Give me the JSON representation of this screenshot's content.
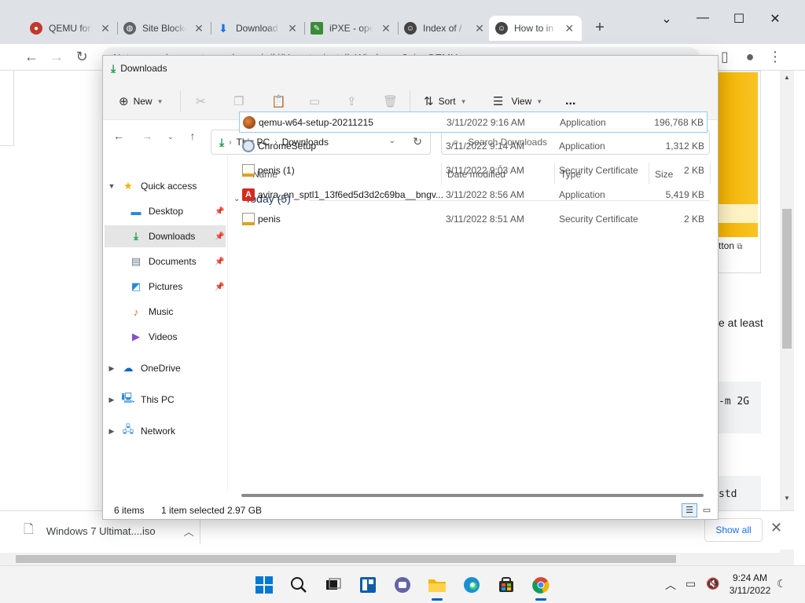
{
  "browser": {
    "tabs": [
      {
        "title": "QEMU for",
        "icon": "qemu-icon"
      },
      {
        "title": "Site Blocke",
        "icon": "globe-icon"
      },
      {
        "title": "Download",
        "icon": "download-icon"
      },
      {
        "title": "iPXE - ope",
        "icon": "ipxe-icon"
      },
      {
        "title": "Index of /",
        "icon": "web-icon"
      },
      {
        "title": "How to in",
        "icon": "web-icon"
      }
    ],
    "url": "Not secure | computernewb.com/wiki/How_to_install_Windows_8_in_QEMU",
    "page_text": {
      "button_fragment": "tton",
      "at_least": "e at least",
      "code1": "-m 2G",
      "code2": "std"
    },
    "download_bar": {
      "file": "Windows 7 Ultimat....iso",
      "show_all": "Show all"
    }
  },
  "explorer": {
    "title": "Downloads",
    "commands": {
      "new": "New",
      "sort": "Sort",
      "view": "View",
      "more": "..."
    },
    "address": {
      "segments": [
        "This PC",
        "Downloads"
      ]
    },
    "search_placeholder": "Search Downloads",
    "sidebar": [
      {
        "label": "Quick access",
        "icon": "star-icon",
        "pinned": false
      },
      {
        "label": "Desktop",
        "icon": "desktop-icon",
        "pinned": true
      },
      {
        "label": "Downloads",
        "icon": "download-icon",
        "pinned": true,
        "selected": true
      },
      {
        "label": "Documents",
        "icon": "documents-icon",
        "pinned": true
      },
      {
        "label": "Pictures",
        "icon": "pictures-icon",
        "pinned": true
      },
      {
        "label": "Music",
        "icon": "music-icon",
        "pinned": false
      },
      {
        "label": "Videos",
        "icon": "videos-icon",
        "pinned": false
      },
      {
        "label": "OneDrive",
        "icon": "cloud-icon",
        "pinned": false
      },
      {
        "label": "This PC",
        "icon": "pc-icon",
        "pinned": false
      },
      {
        "label": "Network",
        "icon": "network-icon",
        "pinned": false
      }
    ],
    "columns": [
      "Name",
      "Date modified",
      "Type",
      "Size"
    ],
    "group": "Today (5)",
    "files": [
      {
        "name": "qemu-w64-setup-20211215",
        "date": "3/11/2022 9:16 AM",
        "type": "Application",
        "size": "196,768 KB",
        "icon": "qemu-app-icon",
        "selected": true
      },
      {
        "name": "ChromeSetup",
        "date": "3/11/2022 9:14 AM",
        "type": "Application",
        "size": "1,312 KB",
        "icon": "installer-icon"
      },
      {
        "name": "penis (1)",
        "date": "3/11/2022 9:03 AM",
        "type": "Security Certificate",
        "size": "2 KB",
        "icon": "certificate-icon"
      },
      {
        "name": "avira_en_sptl1_13f6ed5d3d2c69ba__bngv...",
        "date": "3/11/2022 8:56 AM",
        "type": "Application",
        "size": "5,419 KB",
        "icon": "avira-icon"
      },
      {
        "name": "penis",
        "date": "3/11/2022 8:51 AM",
        "type": "Security Certificate",
        "size": "2 KB",
        "icon": "certificate-icon"
      }
    ],
    "status": {
      "items": "6 items",
      "selected": "1 item selected",
      "size": "2.97 GB"
    }
  },
  "taskbar": {
    "time": "9:24 AM",
    "date": "3/11/2022"
  },
  "colors": {
    "accent": "#005fb8",
    "selection_border": "#99c9ef",
    "folder_yellow": "#f5b400"
  }
}
